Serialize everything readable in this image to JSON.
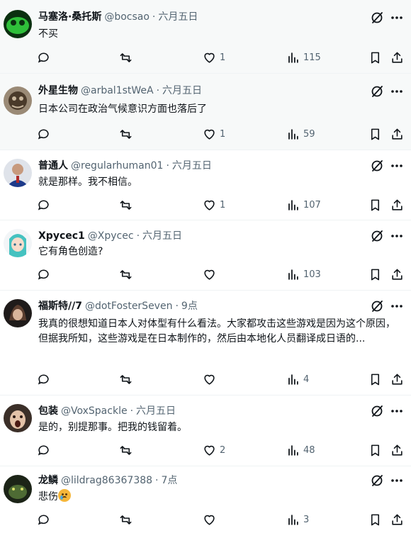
{
  "tweets": [
    {
      "name": "马塞洛·桑托斯",
      "handle": "@bocsao",
      "time": "六月五日",
      "text": "不买",
      "replies": "",
      "retweets": "",
      "likes": "1",
      "views": "115",
      "avatar_color": "#1f7a2a"
    },
    {
      "name": "外星生物",
      "handle": "@arbal1stWeA",
      "time": "六月五日",
      "text": "日本公司在政治气候意识方面也落后了",
      "replies": "",
      "retweets": "",
      "likes": "1",
      "views": "59",
      "avatar_color": "#6b5a48"
    },
    {
      "name": "普通人",
      "handle": "@regularhuman01",
      "time": "六月五日",
      "text": "就是那样。我不相信。",
      "replies": "",
      "retweets": "",
      "likes": "1",
      "views": "107",
      "avatar_color": "#2a3f7a"
    },
    {
      "name": "Xpycec1",
      "handle": "@Xpycec",
      "time": "六月五日",
      "text": "它有角色创造?",
      "replies": "",
      "retweets": "",
      "likes": "",
      "views": "103",
      "avatar_color": "#5fc6c4"
    },
    {
      "name": "福斯特//7",
      "handle": "@dotFosterSeven",
      "time": "9点",
      "text": "我真的很想知道日本人对体型有什么看法。大家都攻击这些游戏是因为这个原因，但据我所知，这些游戏是在日本制作的，然后由本地化人员翻译成日语的...",
      "replies": "",
      "retweets": "",
      "likes": "",
      "views": "4",
      "avatar_color": "#3a2f2c"
    },
    {
      "name": "包装",
      "handle": "@VoxSpackle",
      "time": "六月五日",
      "text": "是的，别提那事。把我的钱留着。",
      "replies": "",
      "retweets": "",
      "likes": "2",
      "views": "48",
      "avatar_color": "#4a3a2e"
    },
    {
      "name": "龙鳞",
      "handle": "@lildrag86367388",
      "time": "7点",
      "text": "悲伤",
      "replies": "",
      "retweets": "",
      "likes": "",
      "views": "3",
      "avatar_color": "#2e3b22"
    }
  ],
  "dot": "·",
  "icons": {
    "reply": "reply-icon",
    "retweet": "retweet-icon",
    "like": "heart-icon",
    "views": "views-icon",
    "bookmark": "bookmark-icon",
    "share": "share-icon",
    "grok": "grok-icon",
    "more": "more-icon"
  }
}
